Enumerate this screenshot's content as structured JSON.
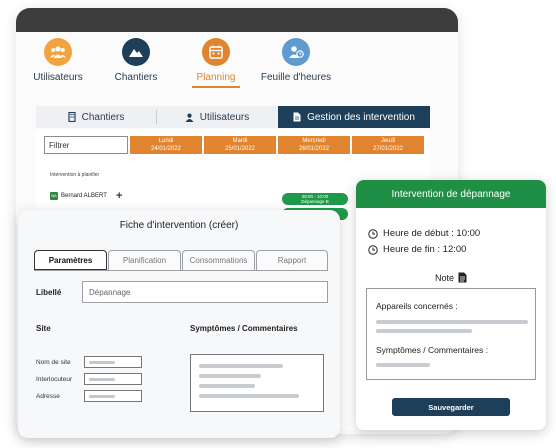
{
  "nav": {
    "items": [
      {
        "label": "Utilisateurs",
        "icon": "users-icon",
        "color": "#f2a340",
        "active": false
      },
      {
        "label": "Chantiers",
        "icon": "mountain-icon",
        "color": "#1e3f5a",
        "active": false
      },
      {
        "label": "Planning",
        "icon": "calendar-icon",
        "color": "#e0842f",
        "active": true
      },
      {
        "label": "Feuille d'heures",
        "icon": "user-clock-icon",
        "color": "#5f9ad0",
        "active": false
      }
    ]
  },
  "tabs": [
    {
      "label": "Chantiers",
      "icon": "building-icon"
    },
    {
      "label": "Utilisateurs",
      "icon": "user-icon"
    },
    {
      "label": "Gestion des intervention",
      "icon": "document-icon",
      "active": true
    }
  ],
  "planning": {
    "filter_placeholder": "Filtrer",
    "days": [
      {
        "name": "Lundi",
        "date": "24/01/2022"
      },
      {
        "name": "Mardi",
        "date": "25/01/2022"
      },
      {
        "name": "Mercredi",
        "date": "26/01/2022"
      },
      {
        "name": "Jeudi",
        "date": "27/01/2022"
      }
    ],
    "section_label": "Intervention à planifier",
    "person": {
      "initials": "BA",
      "name": "Bernard ALBERT"
    },
    "slots": [
      {
        "time": "08:00 - 10:00",
        "label": "Dépannage B"
      },
      {
        "time": "10:00 - 12:00",
        "label": ""
      }
    ]
  },
  "fiche": {
    "title": "Fiche d'intervention (créer)",
    "tabs": [
      "Paramètres",
      "Planification",
      "Consommations",
      "Rapport"
    ],
    "libelle_label": "Libellé",
    "libelle_placeholder": "Dépannage",
    "site_title": "Site",
    "site_fields": [
      "Nom de site",
      "Interlocuteur",
      "Adresse"
    ],
    "symptomes_title": "Symptômes / Commentaires"
  },
  "intervention": {
    "title": "Intervention de dépannage",
    "start": "Heure de début : 10:00",
    "end": "Heure de fin : 12:00",
    "note_label": "Note",
    "appareils_label": "Appareils concernés :",
    "symptomes_label": "Symptômes / Commentaires :",
    "save_label": "Sauvegarder"
  },
  "colors": {
    "accent_orange": "#e0842f",
    "navy": "#1e3f5a",
    "green": "#1f8f45"
  }
}
